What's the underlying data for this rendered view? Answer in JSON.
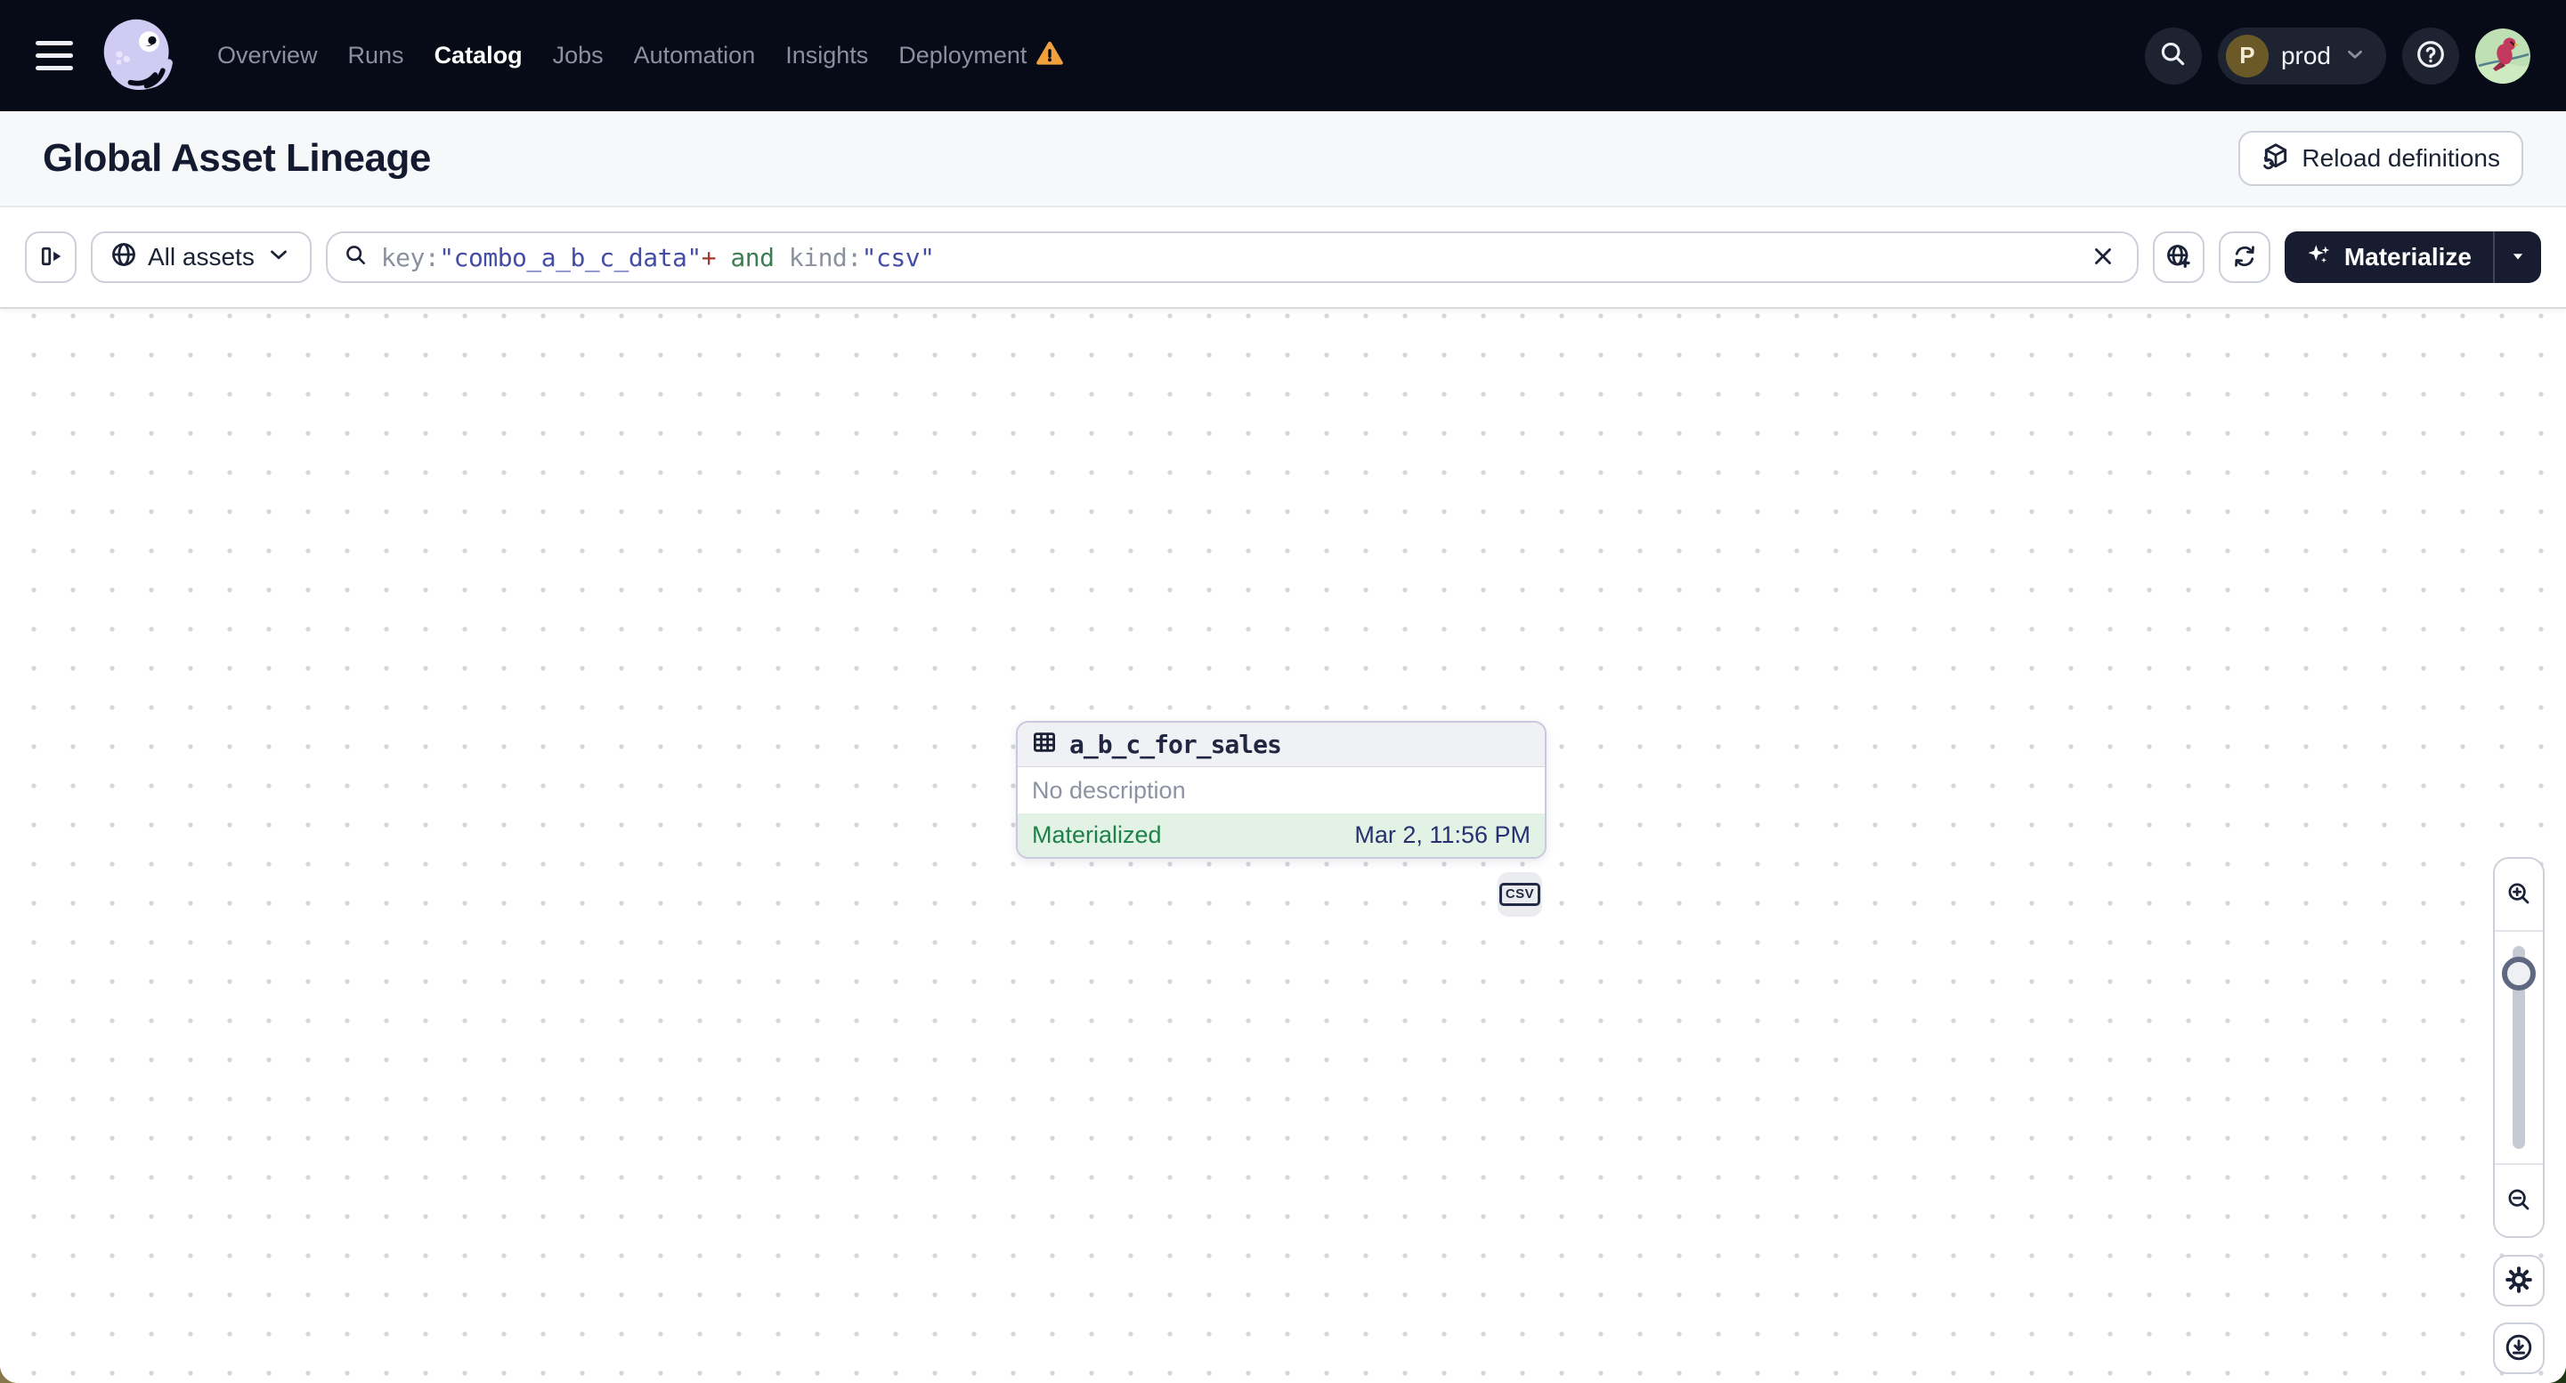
{
  "nav": {
    "items": [
      "Overview",
      "Runs",
      "Catalog",
      "Jobs",
      "Automation",
      "Insights",
      "Deployment"
    ],
    "active_item": "Catalog",
    "environment": {
      "initial": "P",
      "name": "prod"
    }
  },
  "header": {
    "title": "Global Asset Lineage",
    "reload_button_label": "Reload definitions"
  },
  "toolbar": {
    "scope_button_label": "All assets",
    "search_query_segments": [
      {
        "t": "key:",
        "type": "plain"
      },
      {
        "t": "\"combo_a_b_c_data\"",
        "type": "string"
      },
      {
        "t": "+",
        "type": "operator"
      },
      {
        "t": " and ",
        "type": "keyword"
      },
      {
        "t": "kind:",
        "type": "plain"
      },
      {
        "t": "\"csv\"",
        "type": "string"
      }
    ],
    "materialize_button_label": "Materialize"
  },
  "canvas": {
    "asset_node": {
      "name": "a_b_c_for_sales",
      "description": "No description",
      "status": "Materialized",
      "materialized_at": "Mar 2, 11:56 PM"
    },
    "kind_tag": "CSV"
  },
  "colors": {
    "nav_bg": "#070b18",
    "accent_dark": "#181c30",
    "status_green": "#1e8148",
    "status_bg_green": "#e2f3e6",
    "timestamp_blue": "#283071",
    "query_plain": "#8b919e",
    "query_string": "#444da6",
    "query_operator": "#a03a2c",
    "query_keyword": "#3e7d52",
    "warning_orange": "#f0a03c"
  }
}
